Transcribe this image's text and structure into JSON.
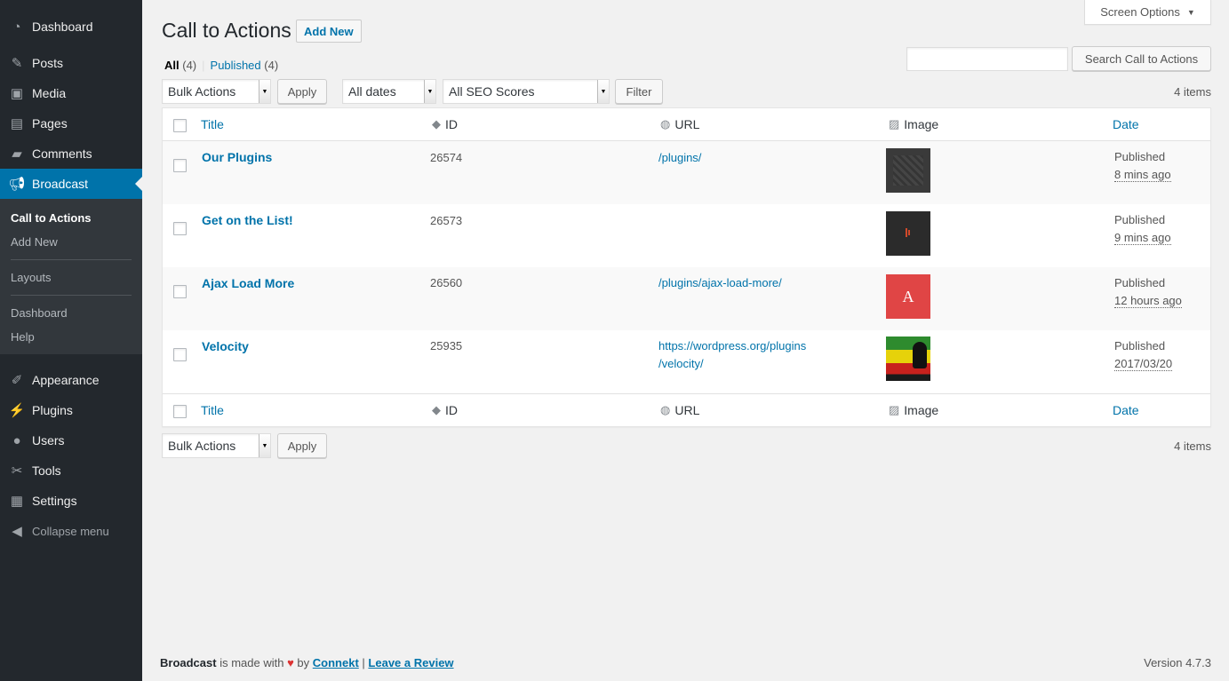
{
  "sidebar": {
    "items_top": [
      {
        "label": "Dashboard",
        "icon": "dashboard-icon",
        "glyph": "◔"
      },
      {
        "label": "Posts",
        "icon": "pin-icon",
        "glyph": "✎"
      },
      {
        "label": "Media",
        "icon": "media-icon",
        "glyph": "▣"
      },
      {
        "label": "Pages",
        "icon": "pages-icon",
        "glyph": "▤"
      },
      {
        "label": "Comments",
        "icon": "comments-icon",
        "glyph": "▰"
      },
      {
        "label": "Broadcast",
        "icon": "megaphone-icon",
        "glyph": "◀"
      }
    ],
    "submenu": [
      "Call to Actions",
      "Add New",
      "Layouts",
      "Dashboard",
      "Help"
    ],
    "items_bottom": [
      {
        "label": "Appearance",
        "icon": "brush-icon",
        "glyph": "✐"
      },
      {
        "label": "Plugins",
        "icon": "plugin-icon",
        "glyph": "⚡"
      },
      {
        "label": "Users",
        "icon": "users-icon",
        "glyph": "●"
      },
      {
        "label": "Tools",
        "icon": "wrench-icon",
        "glyph": "✂"
      },
      {
        "label": "Settings",
        "icon": "settings-icon",
        "glyph": "▦"
      }
    ],
    "collapse": "Collapse menu"
  },
  "header": {
    "screen_options": "Screen Options",
    "title": "Call to Actions",
    "add_new": "Add New"
  },
  "filters": {
    "all_label": "All",
    "all_count": "(4)",
    "published_label": "Published",
    "published_count": "(4)",
    "search_button": "Search Call to Actions",
    "bulk_actions": "Bulk Actions",
    "apply": "Apply",
    "dates": "All dates",
    "seo": "All SEO Scores",
    "filter": "Filter",
    "items_count": "4 items"
  },
  "table": {
    "columns": {
      "title": "Title",
      "id": "ID",
      "url": "URL",
      "image": "Image",
      "date": "Date"
    },
    "rows": [
      {
        "title": "Our Plugins",
        "id": "26574",
        "url_line1": "/plugins/",
        "url_line2": "",
        "thumb_color": "#3a3a3a",
        "status": "Published",
        "date": "8 mins ago"
      },
      {
        "title": "Get on the List!",
        "id": "26573",
        "url_line1": "",
        "url_line2": "",
        "thumb_color": "#2b2b2b",
        "status": "Published",
        "date": "9 mins ago"
      },
      {
        "title": "Ajax Load More",
        "id": "26560",
        "url_line1": "/plugins/ajax-load-more/",
        "url_line2": "",
        "thumb_color": "#e04545",
        "thumb_letter": "A",
        "status": "Published",
        "date": "12 hours ago"
      },
      {
        "title": "Velocity",
        "id": "25935",
        "url_line1": "https://wordpress.org/plugins",
        "url_line2": "/velocity/",
        "thumb_color": "#1a1a1a",
        "status": "Published",
        "date": "2017/03/20"
      }
    ]
  },
  "footer": {
    "brand": "Broadcast",
    "made_with": "is made with",
    "heart": "♥",
    "by": "by",
    "connekt": "Connekt",
    "sep": "|",
    "review": "Leave a Review",
    "version": "Version 4.7.3"
  }
}
